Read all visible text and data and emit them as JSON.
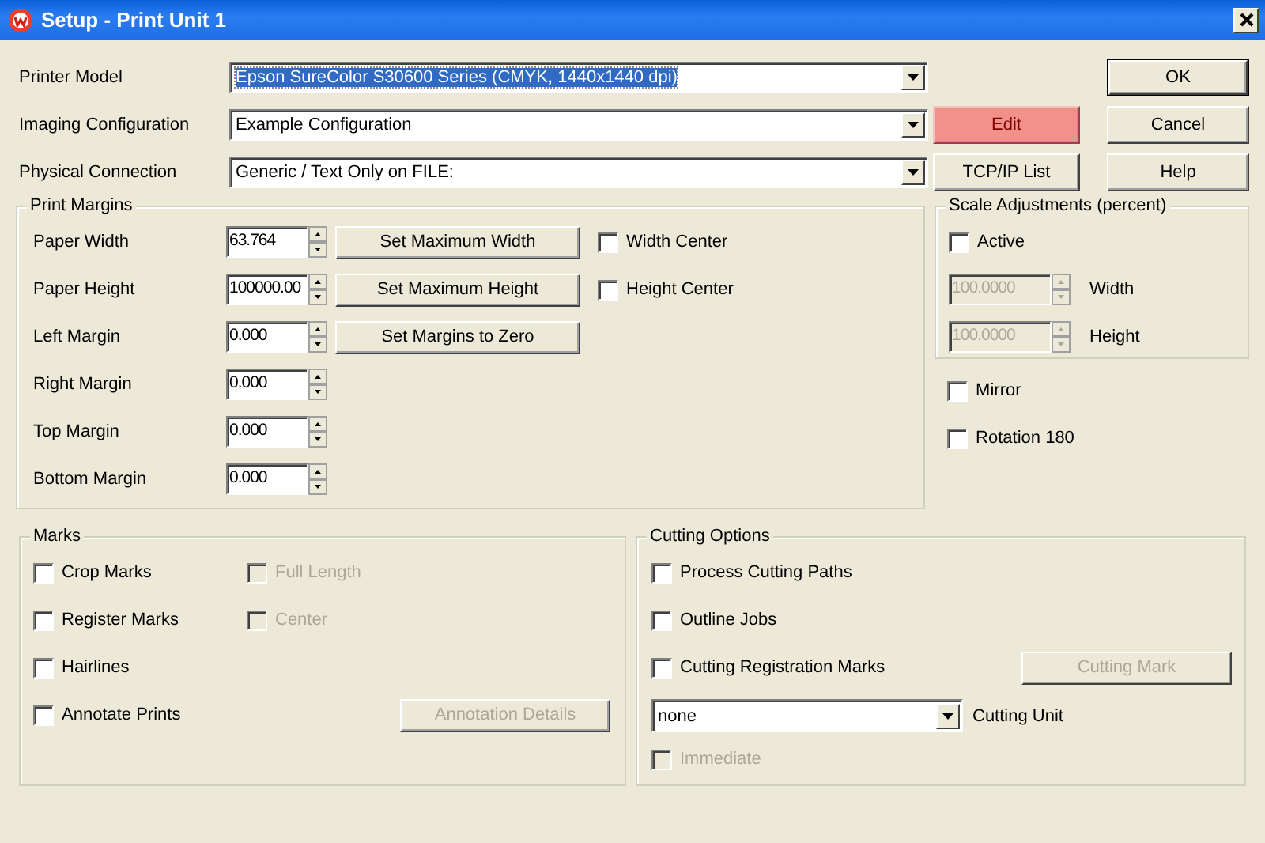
{
  "window": {
    "title": "Setup - Print Unit 1"
  },
  "settings": [
    {
      "label": "Printer Model",
      "value": "Epson  SureColor S30600 Series (CMYK, 1440x1440 dpi)",
      "highlighted": true
    },
    {
      "label": "Imaging Configuration",
      "value": "Example Configuration",
      "highlighted": false,
      "button": {
        "label": "Edit",
        "accent": true
      }
    },
    {
      "label": "Physical Connection",
      "value": "Generic / Text Only on FILE:",
      "highlighted": false,
      "button": {
        "label": "TCP/IP List",
        "accent": false
      }
    }
  ],
  "dialog_buttons": [
    {
      "label": "OK",
      "default": true
    },
    {
      "label": "Cancel",
      "default": false
    },
    {
      "label": "Help",
      "default": false
    }
  ],
  "print_margins": {
    "title": "Print Margins",
    "fields": [
      {
        "label": "Paper Width",
        "value": "63.764",
        "button": "Set Maximum Width",
        "checkbox": {
          "label": "Width Center",
          "checked": false
        }
      },
      {
        "label": "Paper Height",
        "value": "100000.00",
        "button": "Set Maximum Height",
        "checkbox": {
          "label": "Height Center",
          "checked": false
        }
      },
      {
        "label": "Left Margin",
        "value": "0.000",
        "button": "Set Margins to Zero"
      },
      {
        "label": "Right Margin",
        "value": "0.000"
      },
      {
        "label": "Top Margin",
        "value": "0.000"
      },
      {
        "label": "Bottom Margin",
        "value": "0.000"
      }
    ]
  },
  "scale_adjustments": {
    "title": "Scale Adjustments (percent)",
    "active": {
      "label": "Active",
      "checked": false
    },
    "fields": [
      {
        "value": "100.0000",
        "label": "Width",
        "disabled": true
      },
      {
        "value": "100.0000",
        "label": "Height",
        "disabled": true
      }
    ]
  },
  "options": [
    {
      "label": "Mirror",
      "checked": false
    },
    {
      "label": "Rotation  180",
      "checked": false
    }
  ],
  "marks": {
    "title": "Marks",
    "items": [
      {
        "label": "Crop Marks",
        "checked": false,
        "sub": {
          "label": "Full Length",
          "checked": false,
          "disabled": true
        }
      },
      {
        "label": "Register Marks",
        "checked": false,
        "sub": {
          "label": "Center",
          "checked": false,
          "disabled": true
        }
      },
      {
        "label": "Hairlines",
        "checked": false
      },
      {
        "label": "Annotate Prints",
        "checked": false,
        "button": {
          "label": "Annotation Details",
          "disabled": true
        }
      }
    ]
  },
  "cutting_options": {
    "title": "Cutting Options",
    "items": [
      {
        "label": "Process Cutting Paths",
        "checked": false
      },
      {
        "label": "Outline Jobs",
        "checked": false
      },
      {
        "label": "Cutting Registration Marks",
        "checked": false,
        "button": {
          "label": "Cutting Mark",
          "disabled": true
        }
      }
    ],
    "unit": {
      "value": "none",
      "label": "Cutting Unit"
    },
    "immediate": {
      "label": "Immediate",
      "checked": false,
      "disabled": true
    }
  }
}
